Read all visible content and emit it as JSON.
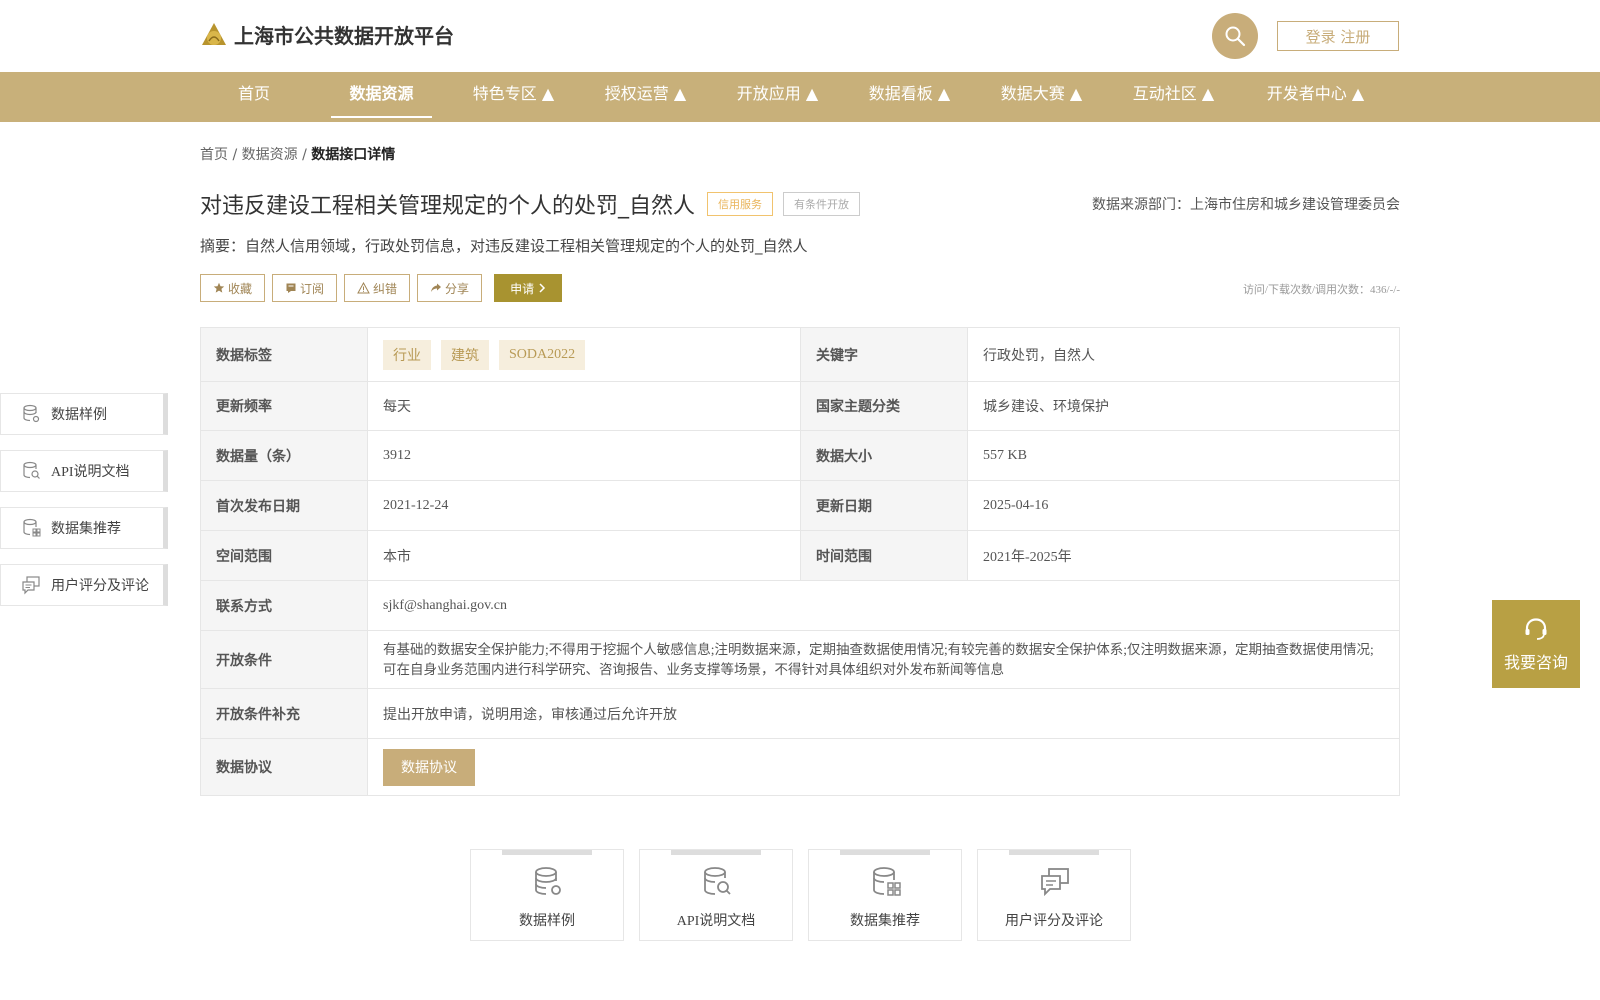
{
  "header": {
    "title": "上海市公共数据开放平台",
    "login_register": "登录 注册"
  },
  "nav": {
    "items": [
      {
        "label": "首页"
      },
      {
        "label": "数据资源"
      },
      {
        "label": "特色专区 ▲"
      },
      {
        "label": "授权运营 ▲"
      },
      {
        "label": "开放应用 ▲"
      },
      {
        "label": "数据看板 ▲"
      },
      {
        "label": "数据大赛 ▲"
      },
      {
        "label": "互动社区 ▲"
      },
      {
        "label": "开发者中心 ▲"
      }
    ],
    "active": "数据资源"
  },
  "breadcrumb": {
    "home": "首页",
    "sep1": "/",
    "resources": "数据资源",
    "sep2": "/",
    "current": "数据接口详情"
  },
  "detail": {
    "title": "对违反建设工程相关管理规定的个人的处罚_自然人",
    "tag_credit": "信用服务",
    "tag_conditional": "有条件开放",
    "source_dept": "数据来源部门：上海市住房和城乡建设管理委员会",
    "summary": "摘要：自然人信用领域，行政处罚信息，对违反建设工程相关管理规定的个人的处罚_自然人",
    "visits": "访问/下载次数/调用次数：436/-/-"
  },
  "actions": {
    "favorite": "收藏",
    "subscribe": "订阅",
    "correct": "纠错",
    "share": "分享",
    "apply": "申请"
  },
  "table": {
    "data_tags_label": "数据标签",
    "data_tags": [
      "行业",
      "建筑",
      "SODA2022"
    ],
    "keywords_label": "关键字",
    "keywords": "行政处罚，自然人",
    "update_freq_label": "更新频率",
    "update_freq": "每天",
    "national_theme_label": "国家主题分类",
    "national_theme": "城乡建设、环境保护",
    "data_count_label": "数据量（条）",
    "data_count": "3912",
    "data_size_label": "数据大小",
    "data_size": "557 KB",
    "first_publish_label": "首次发布日期",
    "first_publish": "2021-12-24",
    "update_date_label": "更新日期",
    "update_date": "2025-04-16",
    "space_range_label": "空间范围",
    "space_range": "本市",
    "time_range_label": "时间范围",
    "time_range": "2021年-2025年",
    "contact_label": "联系方式",
    "contact": "sjkf@shanghai.gov.cn",
    "open_condition_label": "开放条件",
    "open_condition": "有基础的数据安全保护能力;不得用于挖掘个人敏感信息;注明数据来源，定期抽查数据使用情况;有较完善的数据安全保护体系;仅注明数据来源，定期抽查数据使用情况;可在自身业务范围内进行科学研究、咨询报告、业务支撑等场景，不得针对具体组织对外发布新闻等信息",
    "open_condition_extra_label": "开放条件补充",
    "open_condition_extra": "提出开放申请，说明用途，审核通过后允许开放",
    "agreement_label": "数据协议",
    "agreement_button": "数据协议"
  },
  "side_panel": {
    "items": [
      "数据样例",
      "API说明文档",
      "数据集推荐",
      "用户评分及评论"
    ]
  },
  "consult": {
    "label": "我要咨询"
  },
  "bottom_cards": {
    "items": [
      "数据样例",
      "API说明文档",
      "数据集推荐",
      "用户评分及评论"
    ]
  },
  "colors": {
    "brand_gold": "#c8ad7a",
    "apply_olive": "#a89330",
    "consult_gold": "#b8a044"
  }
}
